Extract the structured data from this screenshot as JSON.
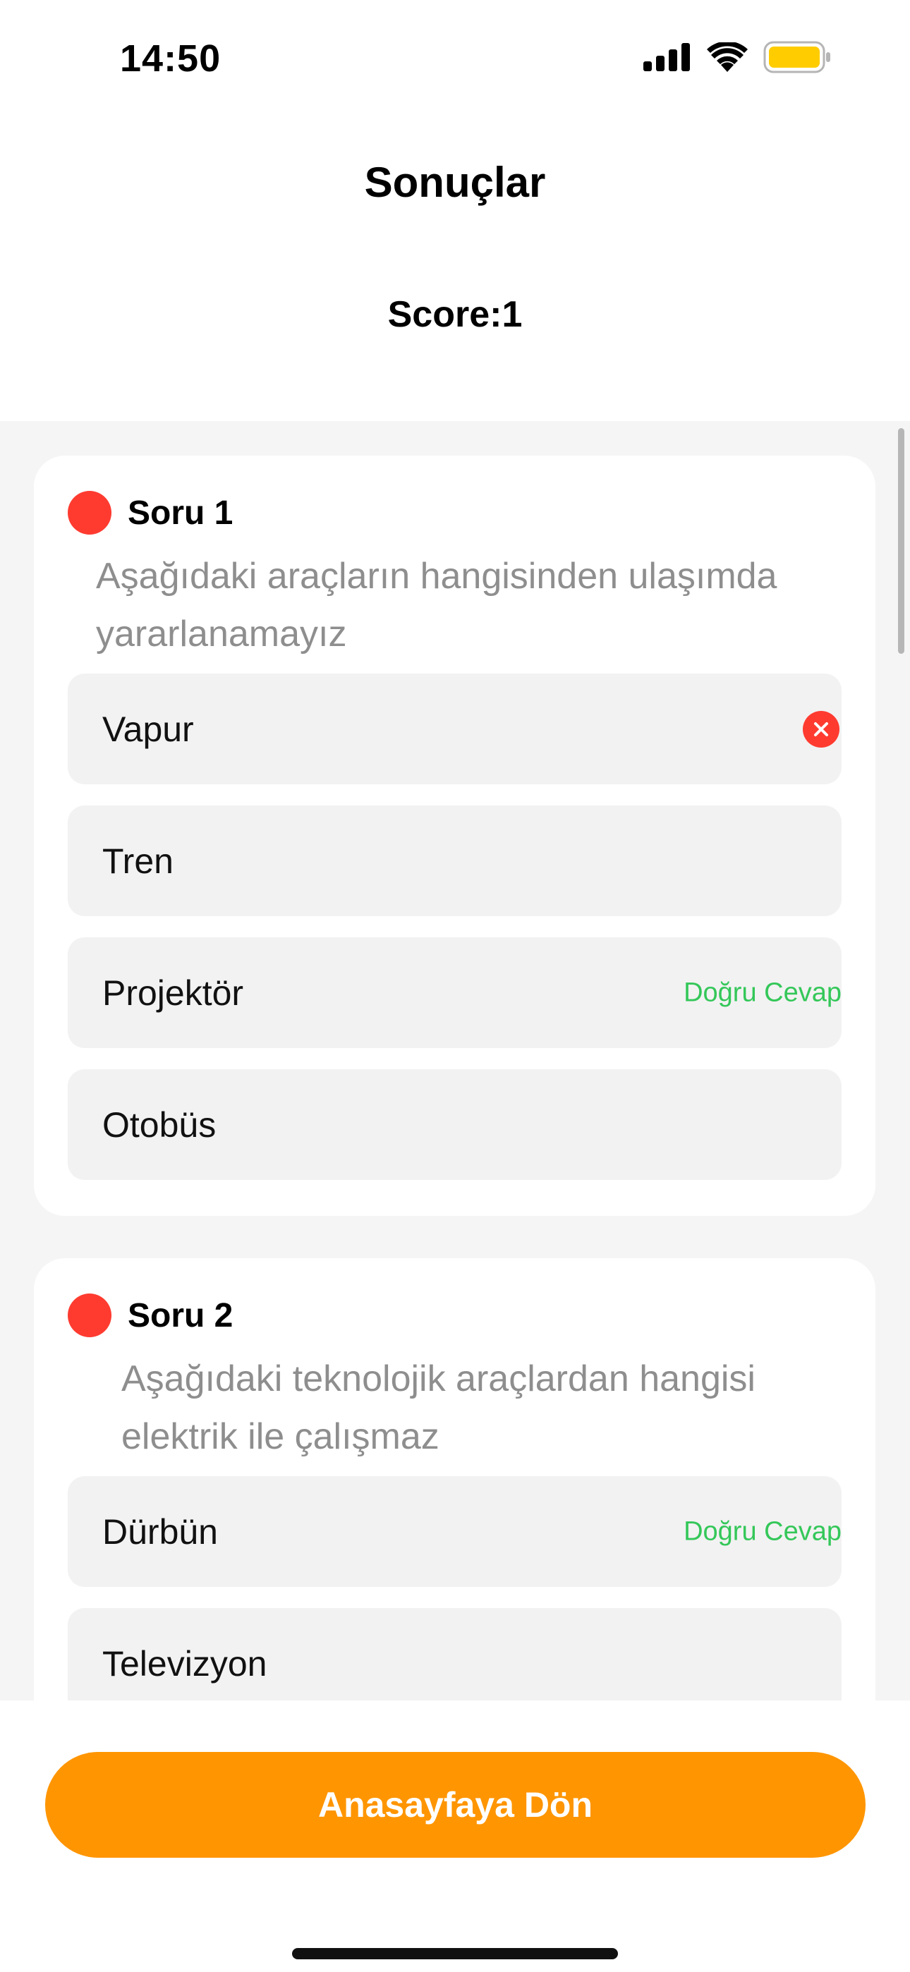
{
  "status_bar": {
    "time": "14:50",
    "icons": [
      "cellular-signal-icon",
      "wifi-icon",
      "battery-icon"
    ],
    "battery_color": "#ffcc00"
  },
  "header": {
    "title": "Sonuçlar",
    "score": "Score:1"
  },
  "questions": [
    {
      "title": "Soru 1",
      "status_color": "#ff3b30",
      "text": "Aşağıdaki araçların hangisinden ulaşımda yararlanamayız",
      "options": [
        {
          "label": "Vapur",
          "marker": "wrong-icon"
        },
        {
          "label": "Tren"
        },
        {
          "label": "Projektör",
          "tag": "Doğru Cevap"
        },
        {
          "label": "Otobüs"
        }
      ]
    },
    {
      "title": "Soru 2",
      "status_color": "#ff3b30",
      "text": "Aşağıdaki teknolojik araçlardan hangisi elektrik ile çalışmaz",
      "options": [
        {
          "label": "Dürbün",
          "tag": "Doğru Cevap"
        },
        {
          "label": "Televizyon"
        }
      ]
    }
  ],
  "footer": {
    "home_button_label": "Anasayfaya Dön",
    "accent_color": "#ff9500"
  }
}
